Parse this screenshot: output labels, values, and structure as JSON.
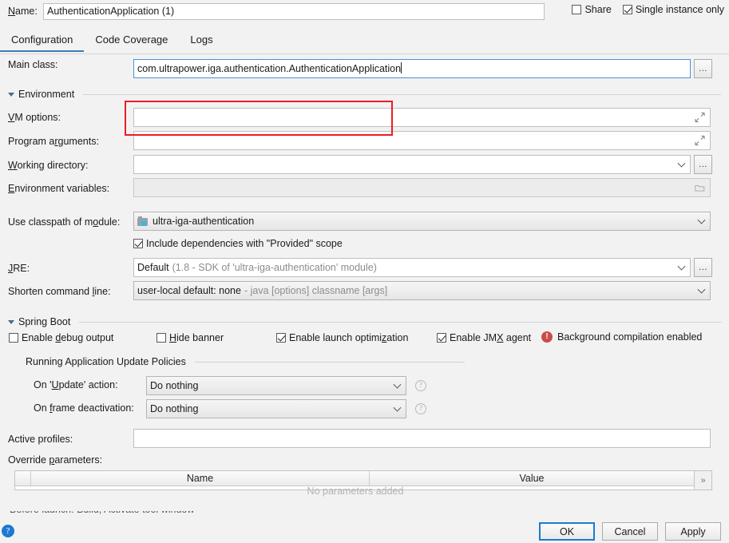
{
  "window": {
    "name_label": "Name:",
    "name_value": "AuthenticationApplication (1)",
    "share_label": "Share",
    "single_instance_label": "Single instance only"
  },
  "tabs": [
    {
      "label": "Configuration",
      "active": true
    },
    {
      "label": "Code Coverage",
      "active": false
    },
    {
      "label": "Logs",
      "active": false
    }
  ],
  "main_class": {
    "label": "Main class:",
    "value": "com.ultrapower.iga.authentication.AuthenticationApplication",
    "browse_label": "..."
  },
  "environment": {
    "section_title": "Environment",
    "vm_options_label": "VM options:",
    "vm_options_value": "",
    "program_arguments_label": "Program arguments:",
    "program_arguments_value": "",
    "working_directory_label": "Working directory:",
    "working_directory_value": "",
    "working_directory_browse": "...",
    "environment_variables_label": "Environment variables:",
    "environment_variables_value": ""
  },
  "classpath": {
    "label": "Use classpath of module:",
    "module": "ultra-iga-authentication",
    "module_icon": "module-icon",
    "include_provided_label": "Include dependencies with \"Provided\" scope",
    "include_provided_checked": true
  },
  "jre": {
    "label": "JRE:",
    "value": "Default",
    "value_hint": "(1.8 - SDK of 'ultra-iga-authentication' module)",
    "browse_label": "..."
  },
  "shorten": {
    "label": "Shorten command line:",
    "value": "user-local default: none",
    "value_hint": "- java [options] classname [args]"
  },
  "spring_boot": {
    "section_title": "Spring Boot",
    "checkboxes": [
      {
        "label": "Enable debug output",
        "checked": false
      },
      {
        "label": "Hide banner",
        "checked": false
      },
      {
        "label": "Enable launch optimization",
        "checked": true
      },
      {
        "label": "Enable JMX agent",
        "checked": true
      }
    ],
    "warning_text": "Background compilation enabled",
    "warning_icon": "error-circle-icon",
    "policies_title": "Running Application Update Policies",
    "on_update_label": "On 'Update' action:",
    "on_update_value": "Do nothing",
    "on_frame_label": "On frame deactivation:",
    "on_frame_value": "Do nothing",
    "help_icon": "question-mark-icon",
    "active_profiles_label": "Active profiles:",
    "active_profiles_value": "",
    "override_parameters_label": "Override parameters:"
  },
  "params_table": {
    "columns": [
      "Name",
      "Value"
    ],
    "empty_text": "No parameters added",
    "expand_label": "»"
  },
  "footer": {
    "help_label": "?",
    "buttons": [
      {
        "label": "OK",
        "default": true
      },
      {
        "label": "Cancel",
        "default": false
      },
      {
        "label": "Apply",
        "default": false
      }
    ]
  },
  "annotation": {
    "color": "#ee1c25",
    "target": "vm-options-field"
  }
}
